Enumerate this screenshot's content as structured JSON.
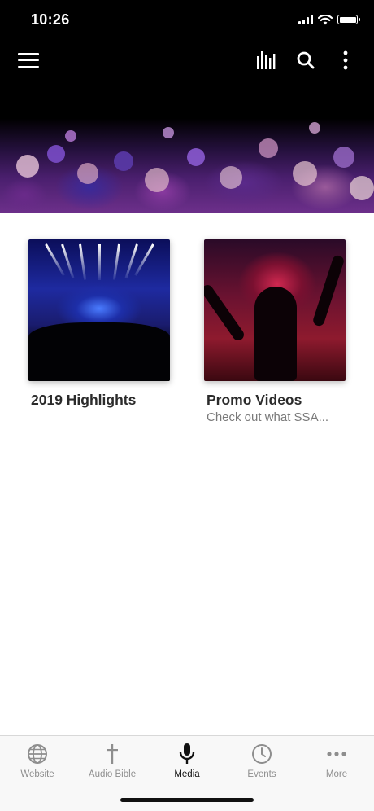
{
  "status_bar": {
    "time": "10:26"
  },
  "header": {
    "menu_icon": "hamburger-icon",
    "actions": [
      "bars-icon",
      "search-icon",
      "more-vertical-icon"
    ]
  },
  "content": {
    "cards": [
      {
        "title": "2019 Highlights",
        "subtitle": ""
      },
      {
        "title": "Promo Videos",
        "subtitle": "Check out what SSA..."
      }
    ]
  },
  "tabbar": {
    "active": "Media",
    "tabs": [
      {
        "label": "Website",
        "icon": "globe-icon"
      },
      {
        "label": "Audio Bible",
        "icon": "cross-icon"
      },
      {
        "label": "Media",
        "icon": "microphone-icon"
      },
      {
        "label": "Events",
        "icon": "clock-icon"
      },
      {
        "label": "More",
        "icon": "ellipsis-icon"
      }
    ]
  },
  "colors": {
    "header_bg": "#000000",
    "active_tab": "#111111",
    "inactive_tab": "#8e8e8e",
    "title_text": "#2b2b2b",
    "subtitle_text": "#7a7a7a"
  }
}
